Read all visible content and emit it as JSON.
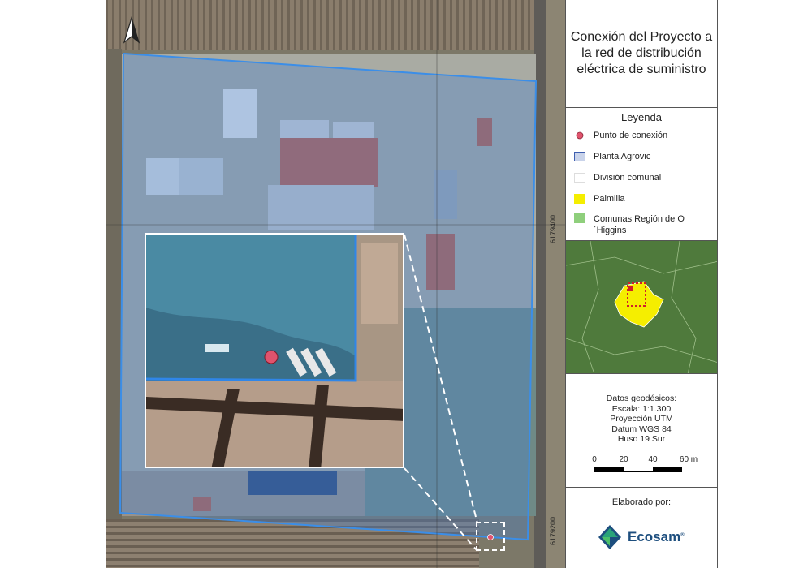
{
  "title": "Conexión del Proyecto a la red de distribución eléctrica de suministro",
  "legend": {
    "title": "Leyenda",
    "items": [
      {
        "label": "Punto de conexión",
        "symbol": "point",
        "color": "#e0536d"
      },
      {
        "label": "Planta Agrovic",
        "symbol": "polygon",
        "color": "#c9d3ea",
        "stroke": "#3f5fb0"
      },
      {
        "label": "División comunal",
        "symbol": "polygon",
        "color": "#ffffff",
        "stroke": "#dddddd"
      },
      {
        "label": "Palmilla",
        "symbol": "polygon",
        "color": "#f5ee00",
        "stroke": "#f5ee00"
      },
      {
        "label": "Comunas Región de O´Higgins",
        "symbol": "polygon",
        "color": "#8fcf7c",
        "stroke": "#8fcf7c"
      }
    ]
  },
  "map": {
    "grid_labels": {
      "north_1": "6179400",
      "north_2": "6179200"
    }
  },
  "datos": {
    "title": "Datos geodésicos:",
    "escala": "Escala: 1:1.300",
    "proyeccion": "Proyección UTM",
    "datum": "Datum WGS 84",
    "huso": "Huso 19 Sur"
  },
  "scale": {
    "labels": [
      "0",
      "20",
      "40",
      "60 m"
    ],
    "unit_values": [
      0,
      20,
      40,
      60
    ]
  },
  "credits": {
    "label": "Elaborado por:",
    "company": "Ecosam"
  },
  "colors": {
    "plant_fill": "rgba(70,130,210,0.35)",
    "plant_border": "#3b8ee8",
    "connection_point": "#e0536d",
    "palmilla": "#f5ee00"
  }
}
